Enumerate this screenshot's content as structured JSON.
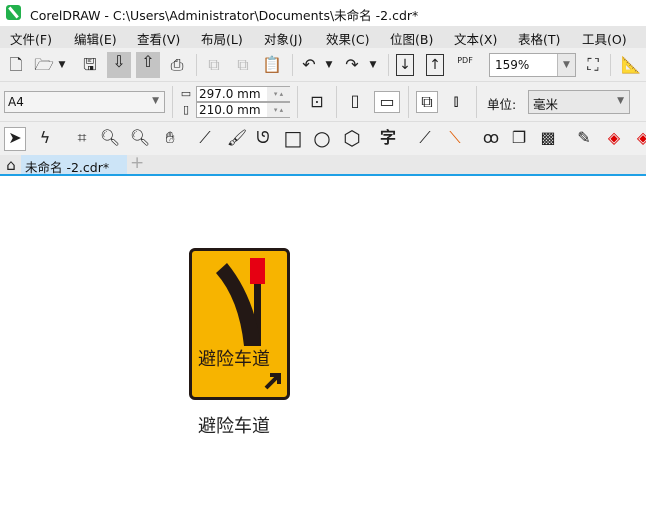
{
  "window": {
    "title": "CorelDRAW - C:\\Users\\Administrator\\Documents\\未命名 -2.cdr*"
  },
  "menu": [
    "文件(F)",
    "编辑(E)",
    "查看(V)",
    "布局(L)",
    "对象(J)",
    "效果(C)",
    "位图(B)",
    "文本(X)",
    "表格(T)",
    "工具(O)"
  ],
  "toolbar": {
    "zoom": "159%",
    "pdf_label": "PDF"
  },
  "property_bar": {
    "page_size": "A4",
    "width": "297.0 mm",
    "height": "210.0 mm",
    "unit_label": "单位:",
    "unit": "毫米"
  },
  "tabs": [
    {
      "label": "未命名 -2.cdr*"
    }
  ],
  "tab_add": "+",
  "canvas": {
    "sign_text": "避险车道",
    "caption": "避险车道",
    "sign_color": "#F7B400",
    "red_color": "#E60012"
  }
}
